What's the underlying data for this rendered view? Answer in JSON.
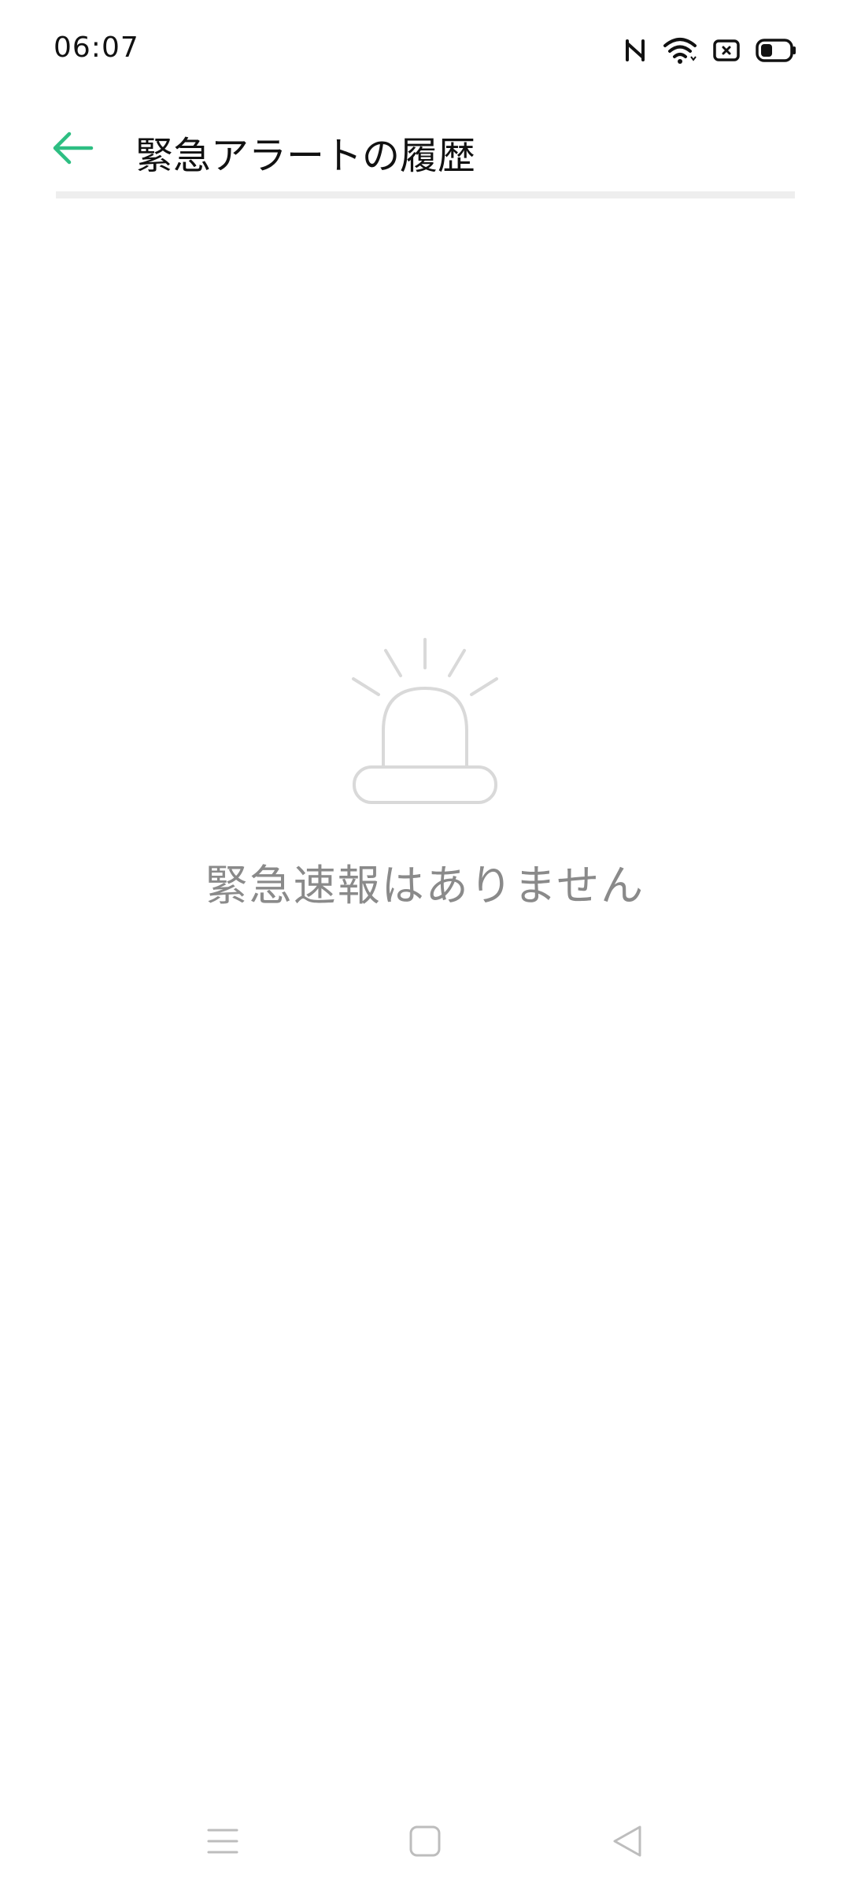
{
  "status_bar": {
    "time": "06:07",
    "icons": [
      "nfc-icon",
      "wifi-icon",
      "sim-error-icon",
      "battery-icon"
    ]
  },
  "app_bar": {
    "back_icon": "arrow-left-icon",
    "title": "緊急アラートの履歴"
  },
  "empty_state": {
    "icon": "alarm-siren-icon",
    "message": "緊急速報はありません"
  },
  "nav_bar": {
    "icons": [
      "menu-icon",
      "home-icon",
      "back-icon"
    ]
  },
  "colors": {
    "accent": "#2DBE82",
    "title_text": "#111111",
    "empty_text": "#8A8A8A",
    "icon_gray": "#D9D9D9",
    "divider": "#EEEEEE"
  }
}
